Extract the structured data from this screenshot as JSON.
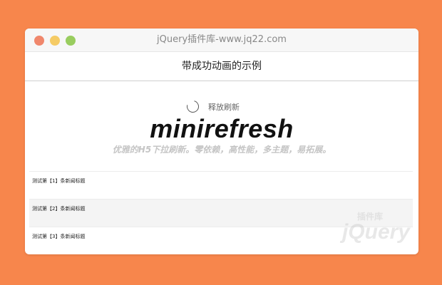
{
  "window": {
    "title": "jQuery插件库-www.jq22.com"
  },
  "header": {
    "title": "带成功动画的示例"
  },
  "refresh": {
    "status_text": "释放刷新"
  },
  "brand": {
    "name": "minirefresh",
    "tagline": "优雅的H5下拉刷新。零依赖，高性能，多主题，易拓展。"
  },
  "list": {
    "items": [
      {
        "label": "测试第【1】条新闻标题"
      },
      {
        "label": "测试第【2】条新闻标题"
      },
      {
        "label": "测试第【3】条新闻标题"
      }
    ]
  },
  "watermark": {
    "cn": "插件库",
    "logo": "jQuery"
  },
  "colors": {
    "background": "#f7864c",
    "traffic_red": "#f0876c",
    "traffic_yellow": "#f5cb65",
    "traffic_green": "#99cd5f"
  }
}
